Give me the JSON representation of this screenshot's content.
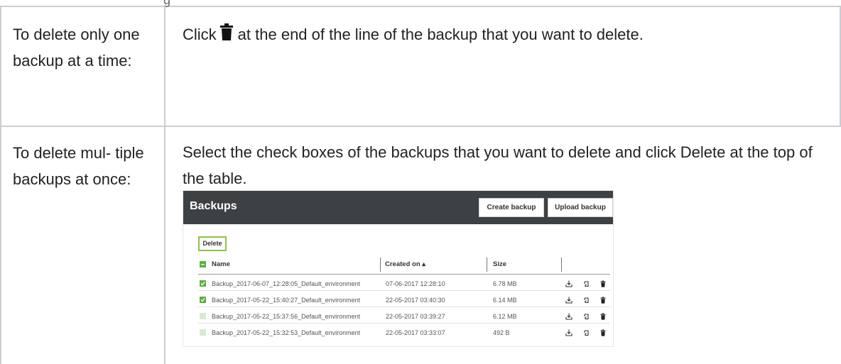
{
  "header_fragment": "g",
  "table": {
    "row1_label": "To delete only one backup at a time:",
    "row1_text_before": "Click",
    "row1_text_after": "at the end of the line of the backup that you want to delete.",
    "row2_label": "To delete mul- tiple backups at once:",
    "row2_text_before": "Select the check boxes of the backups that you want to delete and click",
    "row2_text_bold": "Delete",
    "row2_text_after": "at the top of the table."
  },
  "screenshot": {
    "title": "Backups",
    "create_button": "Create backup",
    "upload_button": "Upload backup",
    "delete_button": "Delete",
    "columns": {
      "name": "Name",
      "created": "Created on ▴",
      "size": "Size"
    },
    "rows": [
      {
        "checked": true,
        "name": "Backup_2017-06-07_12:28:05_Default_environment",
        "created": "07-06-2017 12:28:10",
        "size": "6.78 MB"
      },
      {
        "checked": true,
        "name": "Backup_2017-05-22_15:40:27_Default_environment",
        "created": "22-05-2017 03:40:30",
        "size": "6.14 MB"
      },
      {
        "checked": false,
        "name": "Backup_2017-05-22_15:37:56_Default_environment",
        "created": "22-05-2017 03:39:27",
        "size": "6.12 MB"
      },
      {
        "checked": false,
        "name": "Backup_2017-05-22_15:32:53_Default_environment",
        "created": "22-05-2017 03:33:07",
        "size": "492 B"
      }
    ],
    "row_action_icons": [
      "download-icon",
      "restore-icon",
      "trash-icon"
    ],
    "accent_color": "#8cc63f",
    "header_color": "#3d4144"
  }
}
